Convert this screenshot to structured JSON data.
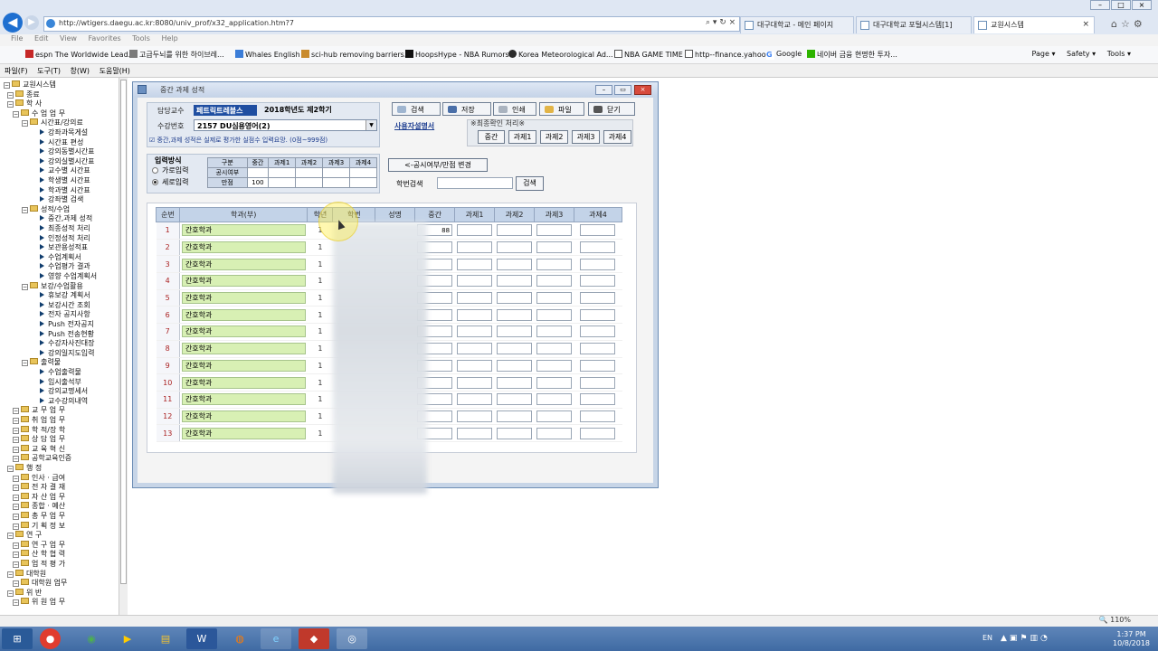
{
  "browser": {
    "url": "http://wtigers.daegu.ac.kr:8080/univ_prof/x32_application.htm?7",
    "tabs": [
      {
        "label": "대구대학교 - 메인 페이지",
        "active": false
      },
      {
        "label": "대구대학교 포털시스템[1]",
        "active": false
      },
      {
        "label": "교원시스템",
        "active": true
      }
    ],
    "menu": [
      "File",
      "Edit",
      "View",
      "Favorites",
      "Tools",
      "Help"
    ],
    "favorites": [
      "espn The Worldwide Lead...",
      "고급두뇌를 위한 하이브레...",
      "Whales English",
      "sci-hub removing barriers...",
      "HoopsHype - NBA Rumors",
      "Korea Meteorological Ad...",
      "NBA GAME TIME",
      "http--finance.yahoo",
      "Google",
      "네이버 금융 현명한 투자..."
    ],
    "tools": [
      "Page ▾",
      "Safety ▾",
      "Tools ▾"
    ],
    "zoom": "110%",
    "accent": "#1e6fd0"
  },
  "app_menu": [
    "파일(F)",
    "도구(T)",
    "창(W)",
    "도움말(H)"
  ],
  "tree": [
    {
      "l": 0,
      "k": "root",
      "t": "교원시스템"
    },
    {
      "l": 1,
      "k": "folder",
      "t": "종료"
    },
    {
      "l": 1,
      "k": "folder",
      "t": "학  사"
    },
    {
      "l": 2,
      "k": "folder",
      "t": "수 업 업 무"
    },
    {
      "l": 3,
      "k": "folder",
      "t": "시간표/강의료"
    },
    {
      "l": 4,
      "k": "leaf",
      "t": "강좌과목게설"
    },
    {
      "l": 4,
      "k": "leaf",
      "t": "시간표 편성"
    },
    {
      "l": 4,
      "k": "leaf",
      "t": "강의동별시간표"
    },
    {
      "l": 4,
      "k": "leaf",
      "t": "강의실별시간표"
    },
    {
      "l": 4,
      "k": "leaf",
      "t": "교수별 시간표"
    },
    {
      "l": 4,
      "k": "leaf",
      "t": "학생별 시간표"
    },
    {
      "l": 4,
      "k": "leaf",
      "t": "학과별 시간표"
    },
    {
      "l": 4,
      "k": "leaf",
      "t": "강좌별 검색"
    },
    {
      "l": 3,
      "k": "folder",
      "t": "성적/수업"
    },
    {
      "l": 4,
      "k": "leaf",
      "t": "중간,과제 성적"
    },
    {
      "l": 4,
      "k": "leaf",
      "t": "최종성적 처리"
    },
    {
      "l": 4,
      "k": "leaf",
      "t": "인정성적 처리"
    },
    {
      "l": 4,
      "k": "leaf",
      "t": "보관용성적표"
    },
    {
      "l": 4,
      "k": "leaf",
      "t": "수업계획서"
    },
    {
      "l": 4,
      "k": "leaf",
      "t": "수업평가 결과"
    },
    {
      "l": 4,
      "k": "leaf",
      "t": "영향 수업계획서"
    },
    {
      "l": 3,
      "k": "folder",
      "t": "보강/수업활용"
    },
    {
      "l": 4,
      "k": "leaf",
      "t": "휴보강 계획서"
    },
    {
      "l": 4,
      "k": "leaf",
      "t": "보강시간 조회"
    },
    {
      "l": 4,
      "k": "leaf",
      "t": "전자 공지사항"
    },
    {
      "l": 4,
      "k": "leaf",
      "t": "Push 전자공지"
    },
    {
      "l": 4,
      "k": "leaf",
      "t": "Push 전송현황"
    },
    {
      "l": 4,
      "k": "leaf",
      "t": "수강자사진대장"
    },
    {
      "l": 4,
      "k": "leaf",
      "t": "강의일지도입력"
    },
    {
      "l": 3,
      "k": "folder",
      "t": "출력물"
    },
    {
      "l": 4,
      "k": "leaf",
      "t": "수업출력물"
    },
    {
      "l": 4,
      "k": "leaf",
      "t": "임시출석부"
    },
    {
      "l": 4,
      "k": "leaf",
      "t": "강의교명세서"
    },
    {
      "l": 4,
      "k": "leaf",
      "t": "교수강의내역"
    },
    {
      "l": 2,
      "k": "folder",
      "t": "교 무 업 무"
    },
    {
      "l": 2,
      "k": "folder",
      "t": "취 업 업 무"
    },
    {
      "l": 2,
      "k": "folder",
      "t": "학 적/장 학"
    },
    {
      "l": 2,
      "k": "folder",
      "t": "상 담 업 무"
    },
    {
      "l": 2,
      "k": "folder",
      "t": "교 육 혁 신"
    },
    {
      "l": 2,
      "k": "folder",
      "t": "공학교육인증"
    },
    {
      "l": 1,
      "k": "folder",
      "t": "행  정"
    },
    {
      "l": 2,
      "k": "folder",
      "t": "인사 · 급여"
    },
    {
      "l": 2,
      "k": "folder",
      "t": "전 자 결 재"
    },
    {
      "l": 2,
      "k": "folder",
      "t": "자 산 업 무"
    },
    {
      "l": 2,
      "k": "folder",
      "t": "종합 · 예산"
    },
    {
      "l": 2,
      "k": "folder",
      "t": "총 무 업 무"
    },
    {
      "l": 2,
      "k": "folder",
      "t": "기 획 정 보"
    },
    {
      "l": 1,
      "k": "folder",
      "t": "연  구"
    },
    {
      "l": 2,
      "k": "folder",
      "t": "연 구 업 무"
    },
    {
      "l": 2,
      "k": "folder",
      "t": "산 학 협 력"
    },
    {
      "l": 2,
      "k": "folder",
      "t": "업 적 평 가"
    },
    {
      "l": 1,
      "k": "folder",
      "t": "대학원"
    },
    {
      "l": 2,
      "k": "folder",
      "t": "대학원 업무"
    },
    {
      "l": 1,
      "k": "folder",
      "t": "위  반"
    },
    {
      "l": 2,
      "k": "folder",
      "t": "위 원 업 무"
    }
  ],
  "window": {
    "title": "중간 과제 성적"
  },
  "form": {
    "prof_label": "담당교수",
    "prof_value": "페트릭트레블스",
    "semester": "2018학년도 제2학기",
    "course_label": "수강번호",
    "course_value": "2157  DU심용영어(2)",
    "notice": "☑ 중간,과제 성적은 실제로 평가한 실점수 입력요망. (0점~999점)",
    "buttons": [
      "검색",
      "저장",
      "인쇄",
      "파일",
      "닫기"
    ],
    "manual": "사용자설명서",
    "confirm_label": "※최종확인 처리※",
    "confirm_buttons": [
      "중간",
      "과제1",
      "과제2",
      "과제3",
      "과제4"
    ],
    "input_method_label": "입력방식",
    "radio_horizontal": "가로입력",
    "radio_vertical": "세로입력",
    "radio_selected": "세로입력",
    "mini_headers": [
      "구분",
      "중간",
      "과제1",
      "과제2",
      "과제3",
      "과제4"
    ],
    "mini_row1_label": "공시여부",
    "mini_row2_label": "만점",
    "mini_row2_mid": "100",
    "pub_button": "<-공시여부/만점 변경",
    "sid_label": "학번검색",
    "sid_button": "검색"
  },
  "grid": {
    "headers": [
      "순번",
      "학과(부)",
      "학년",
      "학번",
      "성명",
      "중간",
      "과제1",
      "과제2",
      "과제3",
      "과제4"
    ],
    "rows": [
      {
        "no": "1",
        "dept": "간호학과",
        "year": "1",
        "mid": "88"
      },
      {
        "no": "2",
        "dept": "간호학과",
        "year": "1",
        "mid": ""
      },
      {
        "no": "3",
        "dept": "간호학과",
        "year": "1",
        "mid": ""
      },
      {
        "no": "4",
        "dept": "간호학과",
        "year": "1",
        "mid": ""
      },
      {
        "no": "5",
        "dept": "간호학과",
        "year": "1",
        "mid": ""
      },
      {
        "no": "6",
        "dept": "간호학과",
        "year": "1",
        "mid": ""
      },
      {
        "no": "7",
        "dept": "간호학과",
        "year": "1",
        "mid": ""
      },
      {
        "no": "8",
        "dept": "간호학과",
        "year": "1",
        "mid": ""
      },
      {
        "no": "9",
        "dept": "간호학과",
        "year": "1",
        "mid": ""
      },
      {
        "no": "10",
        "dept": "간호학과",
        "year": "1",
        "mid": ""
      },
      {
        "no": "11",
        "dept": "간호학과",
        "year": "1",
        "mid": ""
      },
      {
        "no": "12",
        "dept": "간호학과",
        "year": "1",
        "mid": ""
      },
      {
        "no": "13",
        "dept": "간호학과",
        "year": "1",
        "mid": ""
      }
    ]
  },
  "taskbar": {
    "lang": "EN",
    "time": "1:37 PM",
    "date": "10/8/2018"
  }
}
